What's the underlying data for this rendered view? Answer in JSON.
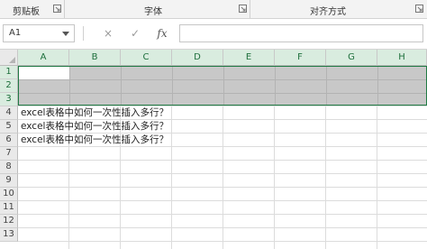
{
  "ribbon": {
    "groups": [
      {
        "label": "剪贴板"
      },
      {
        "label": "字体"
      },
      {
        "label": "对齐方式"
      }
    ]
  },
  "formula_bar": {
    "name_box": "A1",
    "cancel_icon": "×",
    "enter_icon": "✓",
    "fx_label": "fx",
    "formula_value": ""
  },
  "sheet": {
    "columns": [
      "A",
      "B",
      "C",
      "D",
      "E",
      "F",
      "G",
      "H"
    ],
    "rows": [
      "1",
      "2",
      "3",
      "4",
      "5",
      "6",
      "7",
      "8",
      "9",
      "10",
      "11",
      "12",
      "13"
    ],
    "cells": [
      {
        "ref": "A4",
        "value": "excel表格中如何一次性插入多行？"
      },
      {
        "ref": "A5",
        "value": "excel表格中如何一次性插入多行？"
      },
      {
        "ref": "A6",
        "value": "excel表格中如何一次性插入多行？"
      }
    ],
    "selected_range": "A1:H3",
    "selection_color": "#1f7a43"
  }
}
